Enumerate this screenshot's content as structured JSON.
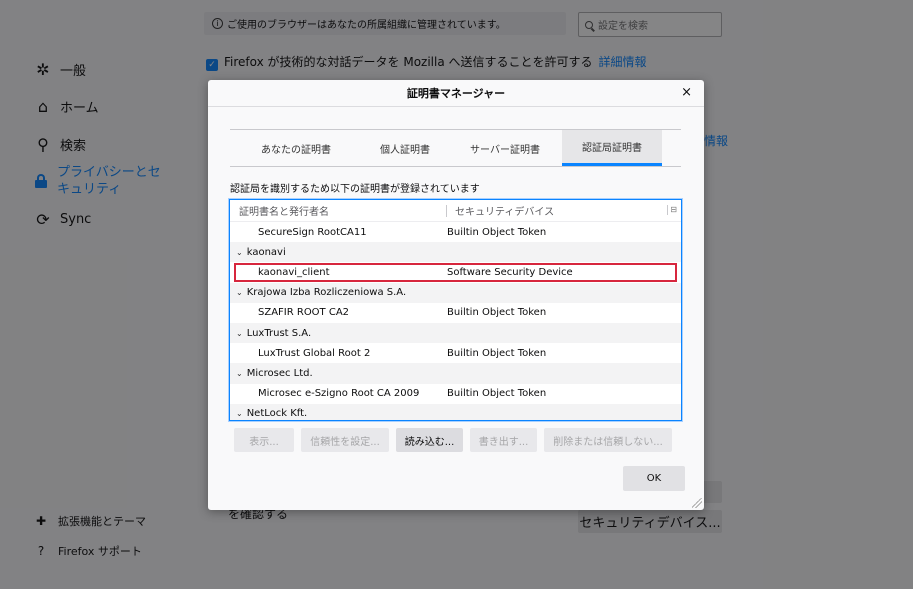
{
  "prefs": {
    "notice": "ご使用のブラウザーはあなたの所属組織に管理されています。",
    "search_placeholder": "設定を検索",
    "top_checkbox_label": "Firefox が技術的な対話データを Mozilla へ送信することを許可する",
    "top_checkbox_link": "詳細情報",
    "nav": [
      {
        "label": "一般",
        "icon": "gear-icon"
      },
      {
        "label": "ホーム",
        "icon": "home-icon"
      },
      {
        "label": "検索",
        "icon": "search-icon"
      },
      {
        "label": "プライバシーとセキュリティ",
        "line1": "プライバシーとセ",
        "line2": "キュリティ",
        "icon": "lock-icon",
        "active": true
      },
      {
        "label": "Sync",
        "icon": "sync-icon"
      }
    ],
    "footer": [
      {
        "label": "拡張機能とテーマ",
        "icon": "puzzle-icon"
      },
      {
        "label": "Firefox サポート",
        "icon": "help-icon"
      }
    ],
    "right_partial_link": "情報",
    "bottom_partial_text": "を確認する",
    "security_devices_button": "セキュリティデバイス..."
  },
  "dialog": {
    "title": "証明書マネージャー",
    "close_glyph": "×",
    "tabs": [
      {
        "label": "あなたの証明書"
      },
      {
        "label": "個人証明書"
      },
      {
        "label": "サーバー証明書"
      },
      {
        "label": "認証局証明書",
        "active": true
      }
    ],
    "description": "認証局を識別するため以下の証明書が登録されています",
    "columns": {
      "name": "証明書名と発行者名",
      "device": "セキュリティデバイス"
    },
    "rows": [
      {
        "type": "cert",
        "name": "SecureSign RootCA11",
        "device": "Builtin Object Token"
      },
      {
        "type": "group",
        "name": "kaonavi"
      },
      {
        "type": "cert",
        "name": "kaonavi_client",
        "device": "Software Security Device",
        "highlighted": true
      },
      {
        "type": "group",
        "name": "Krajowa Izba Rozliczeniowa S.A."
      },
      {
        "type": "cert",
        "name": "SZAFIR ROOT CA2",
        "device": "Builtin Object Token"
      },
      {
        "type": "group",
        "name": "LuxTrust S.A."
      },
      {
        "type": "cert",
        "name": "LuxTrust Global Root 2",
        "device": "Builtin Object Token"
      },
      {
        "type": "group",
        "name": "Microsec Ltd."
      },
      {
        "type": "cert",
        "name": "Microsec e-Szigno Root CA 2009",
        "device": "Builtin Object Token"
      },
      {
        "type": "group",
        "name": "NetLock Kft."
      }
    ],
    "buttons": [
      {
        "label": "表示...",
        "enabled": false
      },
      {
        "label": "信頼性を設定...",
        "enabled": false
      },
      {
        "label": "読み込む...",
        "enabled": true
      },
      {
        "label": "書き出す...",
        "enabled": false
      },
      {
        "label": "削除または信頼しない...",
        "enabled": false
      }
    ],
    "ok_label": "OK"
  },
  "colors": {
    "accent": "#0a84ff",
    "highlight": "#d7263d"
  }
}
